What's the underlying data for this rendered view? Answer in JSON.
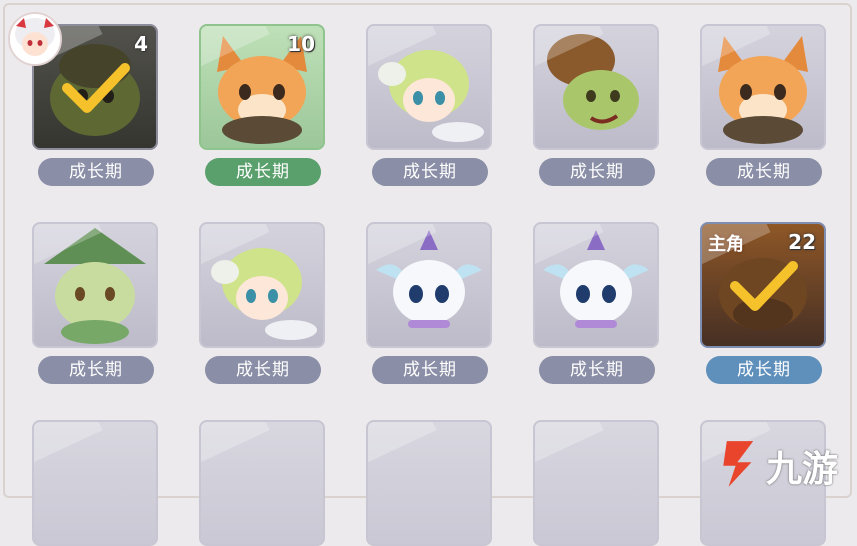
{
  "stage_label": "成长期",
  "lead_label": "主角",
  "watermark_text": "九游",
  "slots": [
    {
      "count": "4",
      "state": "selected",
      "portrait": "turtle-icon"
    },
    {
      "count": "10",
      "state": "active",
      "portrait": "fox-icon"
    },
    {
      "count": "",
      "state": "normal",
      "portrait": "sprout-girl-icon"
    },
    {
      "count": "",
      "state": "normal",
      "portrait": "turtle-icon"
    },
    {
      "count": "",
      "state": "normal",
      "portrait": "fox-icon"
    },
    {
      "count": "",
      "state": "normal",
      "portrait": "leaf-cat-icon"
    },
    {
      "count": "",
      "state": "normal",
      "portrait": "sprout-girl-icon"
    },
    {
      "count": "",
      "state": "normal",
      "portrait": "crystal-dragon-icon"
    },
    {
      "count": "",
      "state": "normal",
      "portrait": "crystal-dragon-icon"
    },
    {
      "count": "22",
      "state": "lead-selected",
      "portrait": "fox-icon"
    }
  ],
  "colors": {
    "label_default": "#8a8ea6",
    "label_active": "#5aa06c",
    "label_lead": "#5f8fbb",
    "check": "#f5c22c"
  }
}
